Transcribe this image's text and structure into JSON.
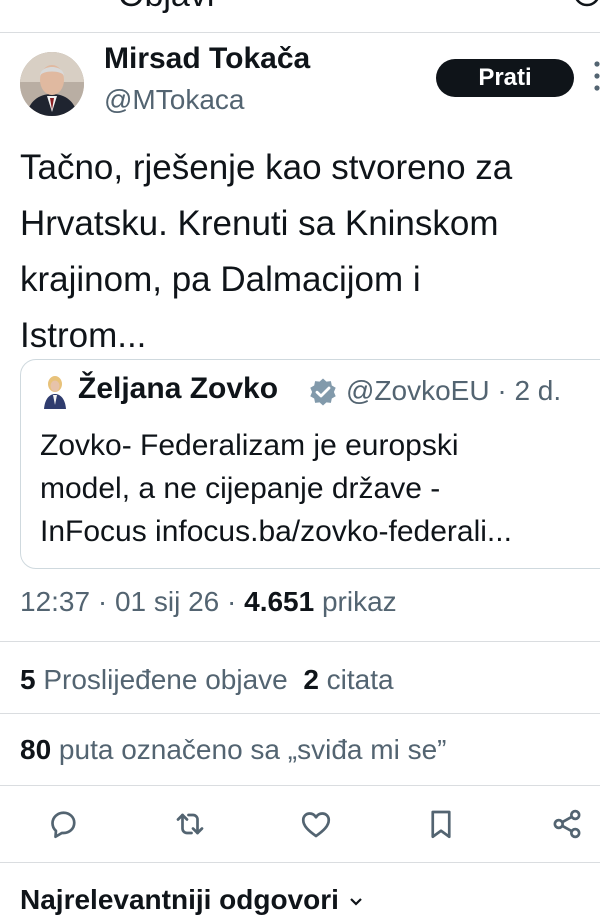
{
  "header": {
    "title": "Objavi"
  },
  "tweet": {
    "author_name": "Mirsad Tokača",
    "author_handle": "@MTokaca",
    "follow_label": "Prati",
    "text": "Tačno, rješenje kao stvoreno za\nHrvatsku. Krenuti sa Kninskom\nkrajinom, pa Dalmacijom i\nIstrom...",
    "time": "12:37 · 01 sij 26 · ",
    "views_count": "4.651",
    "views_label": " prikaz"
  },
  "quote": {
    "author_name": "Željana Zovko",
    "handle_date": "@ZovkoEU · 2 d.",
    "text": "Zovko- Federalizam je europski\nmodel, a ne cijepanje države -\nInFocus infocus.ba/zovko-federali..."
  },
  "stats": {
    "reposts_count": "5",
    "reposts_label": " Proslijeđene objave",
    "quotes_count": "2",
    "quotes_label": " citata",
    "likes_count": "80",
    "likes_label": " puta označeno sa „sviđa mi se”"
  },
  "actions": [
    {
      "icon": "reply-icon"
    },
    {
      "icon": "repost-icon"
    },
    {
      "icon": "like-icon"
    },
    {
      "icon": "bookmark-icon"
    },
    {
      "icon": "share-icon"
    }
  ],
  "replies": {
    "heading": "Najrelevantniji odgovori"
  },
  "colors": {
    "text": "#0f1419",
    "secondary": "#536471",
    "border": "#cfd9de",
    "verified": "#829aab"
  }
}
